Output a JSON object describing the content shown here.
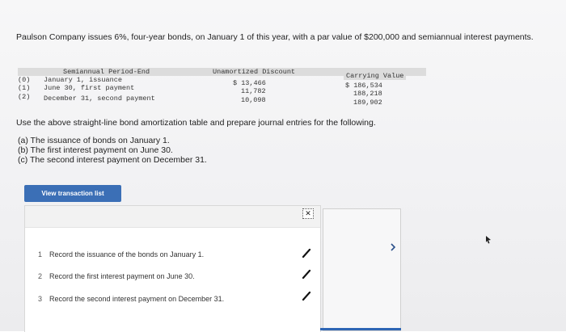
{
  "problem": {
    "intro": "Paulson Company issues 6%, four-year bonds, on January 1 of this year, with a par value of $200,000 and semiannual interest payments.",
    "instruction": "Use the above straight-line bond amortization table and prepare journal entries for the following.",
    "parts": [
      "(a) The issuance of bonds on January 1.",
      "(b) The first interest payment on June 30.",
      "(c) The second interest payment on December 31."
    ]
  },
  "amortization_table": {
    "headers": {
      "period": "Semiannual Period-End",
      "discount": "Unamortized Discount",
      "carrying": "Carrying Value"
    },
    "rows": [
      {
        "index": "(0)",
        "period": "January 1, issuance",
        "discount": "$ 13,466",
        "carrying": "$ 186,534"
      },
      {
        "index": "(1)",
        "period": "June 30, first payment",
        "discount": "11,782",
        "carrying": "188,218"
      },
      {
        "index": "(2)",
        "period": "December 31, second payment",
        "discount": "10,098",
        "carrying": "189,902"
      }
    ]
  },
  "transactions": {
    "button_label": "View transaction list",
    "items": [
      {
        "number": "1",
        "label": "Record the issuance of the bonds on January 1."
      },
      {
        "number": "2",
        "label": "Record the first interest payment on June 30."
      },
      {
        "number": "3",
        "label": "Record the second interest payment on December 31."
      }
    ]
  },
  "colors": {
    "button": "#3b6fb6",
    "accent_line": "#2e66b5"
  },
  "icons": {
    "excel": "excel-icon",
    "check": "checkmark-icon",
    "next": "chevron-right-icon",
    "cursor": "mouse-cursor-icon"
  }
}
